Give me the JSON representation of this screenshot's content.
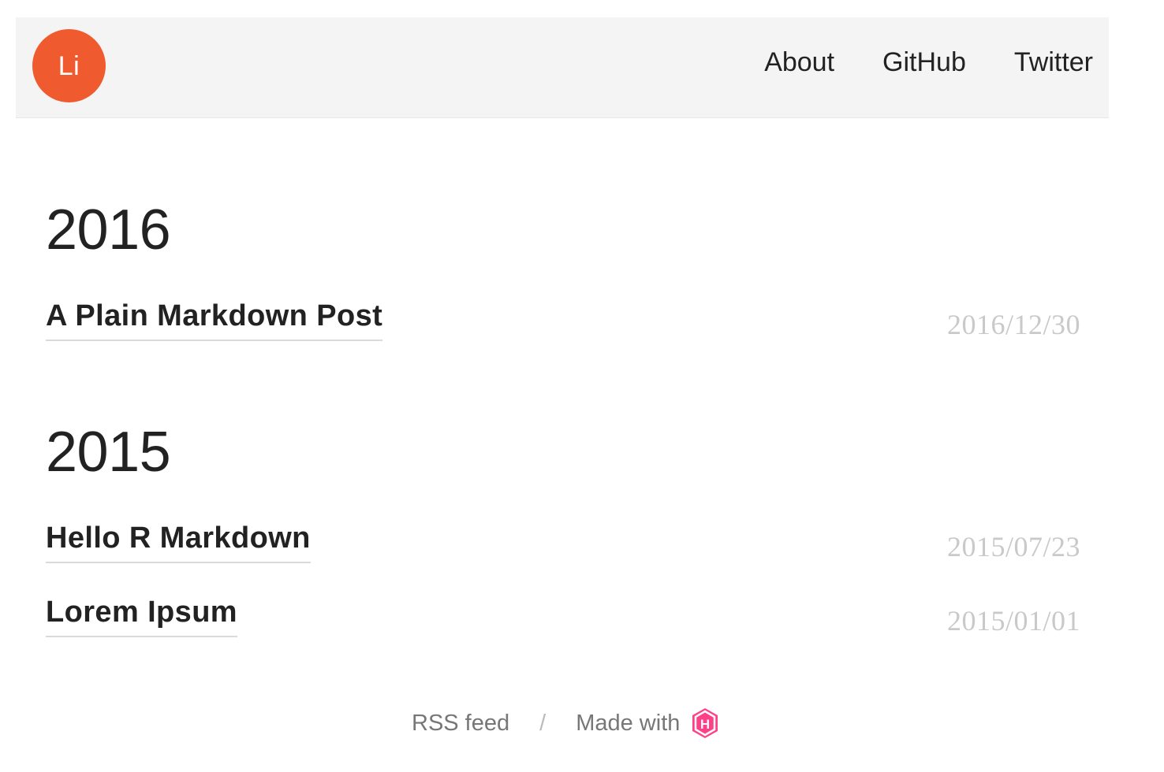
{
  "header": {
    "logo_text": "Li",
    "nav": [
      {
        "label": "About"
      },
      {
        "label": "GitHub"
      },
      {
        "label": "Twitter"
      }
    ]
  },
  "archive": [
    {
      "year": "2016",
      "posts": [
        {
          "title": "A Plain Markdown Post",
          "date": "2016/12/30"
        }
      ]
    },
    {
      "year": "2015",
      "posts": [
        {
          "title": "Hello R Markdown",
          "date": "2015/07/23"
        },
        {
          "title": "Lorem Ipsum",
          "date": "2015/01/01"
        }
      ]
    }
  ],
  "footer": {
    "rss_label": "RSS feed",
    "separator": "/",
    "made_with_label": "Made with",
    "made_with_icon": "hugo-icon",
    "made_with_icon_text": "H"
  },
  "colors": {
    "accent": "#f05a2f",
    "hugo": "#ff4088",
    "header_bg": "#f4f4f4",
    "date": "#c9c9c9"
  }
}
